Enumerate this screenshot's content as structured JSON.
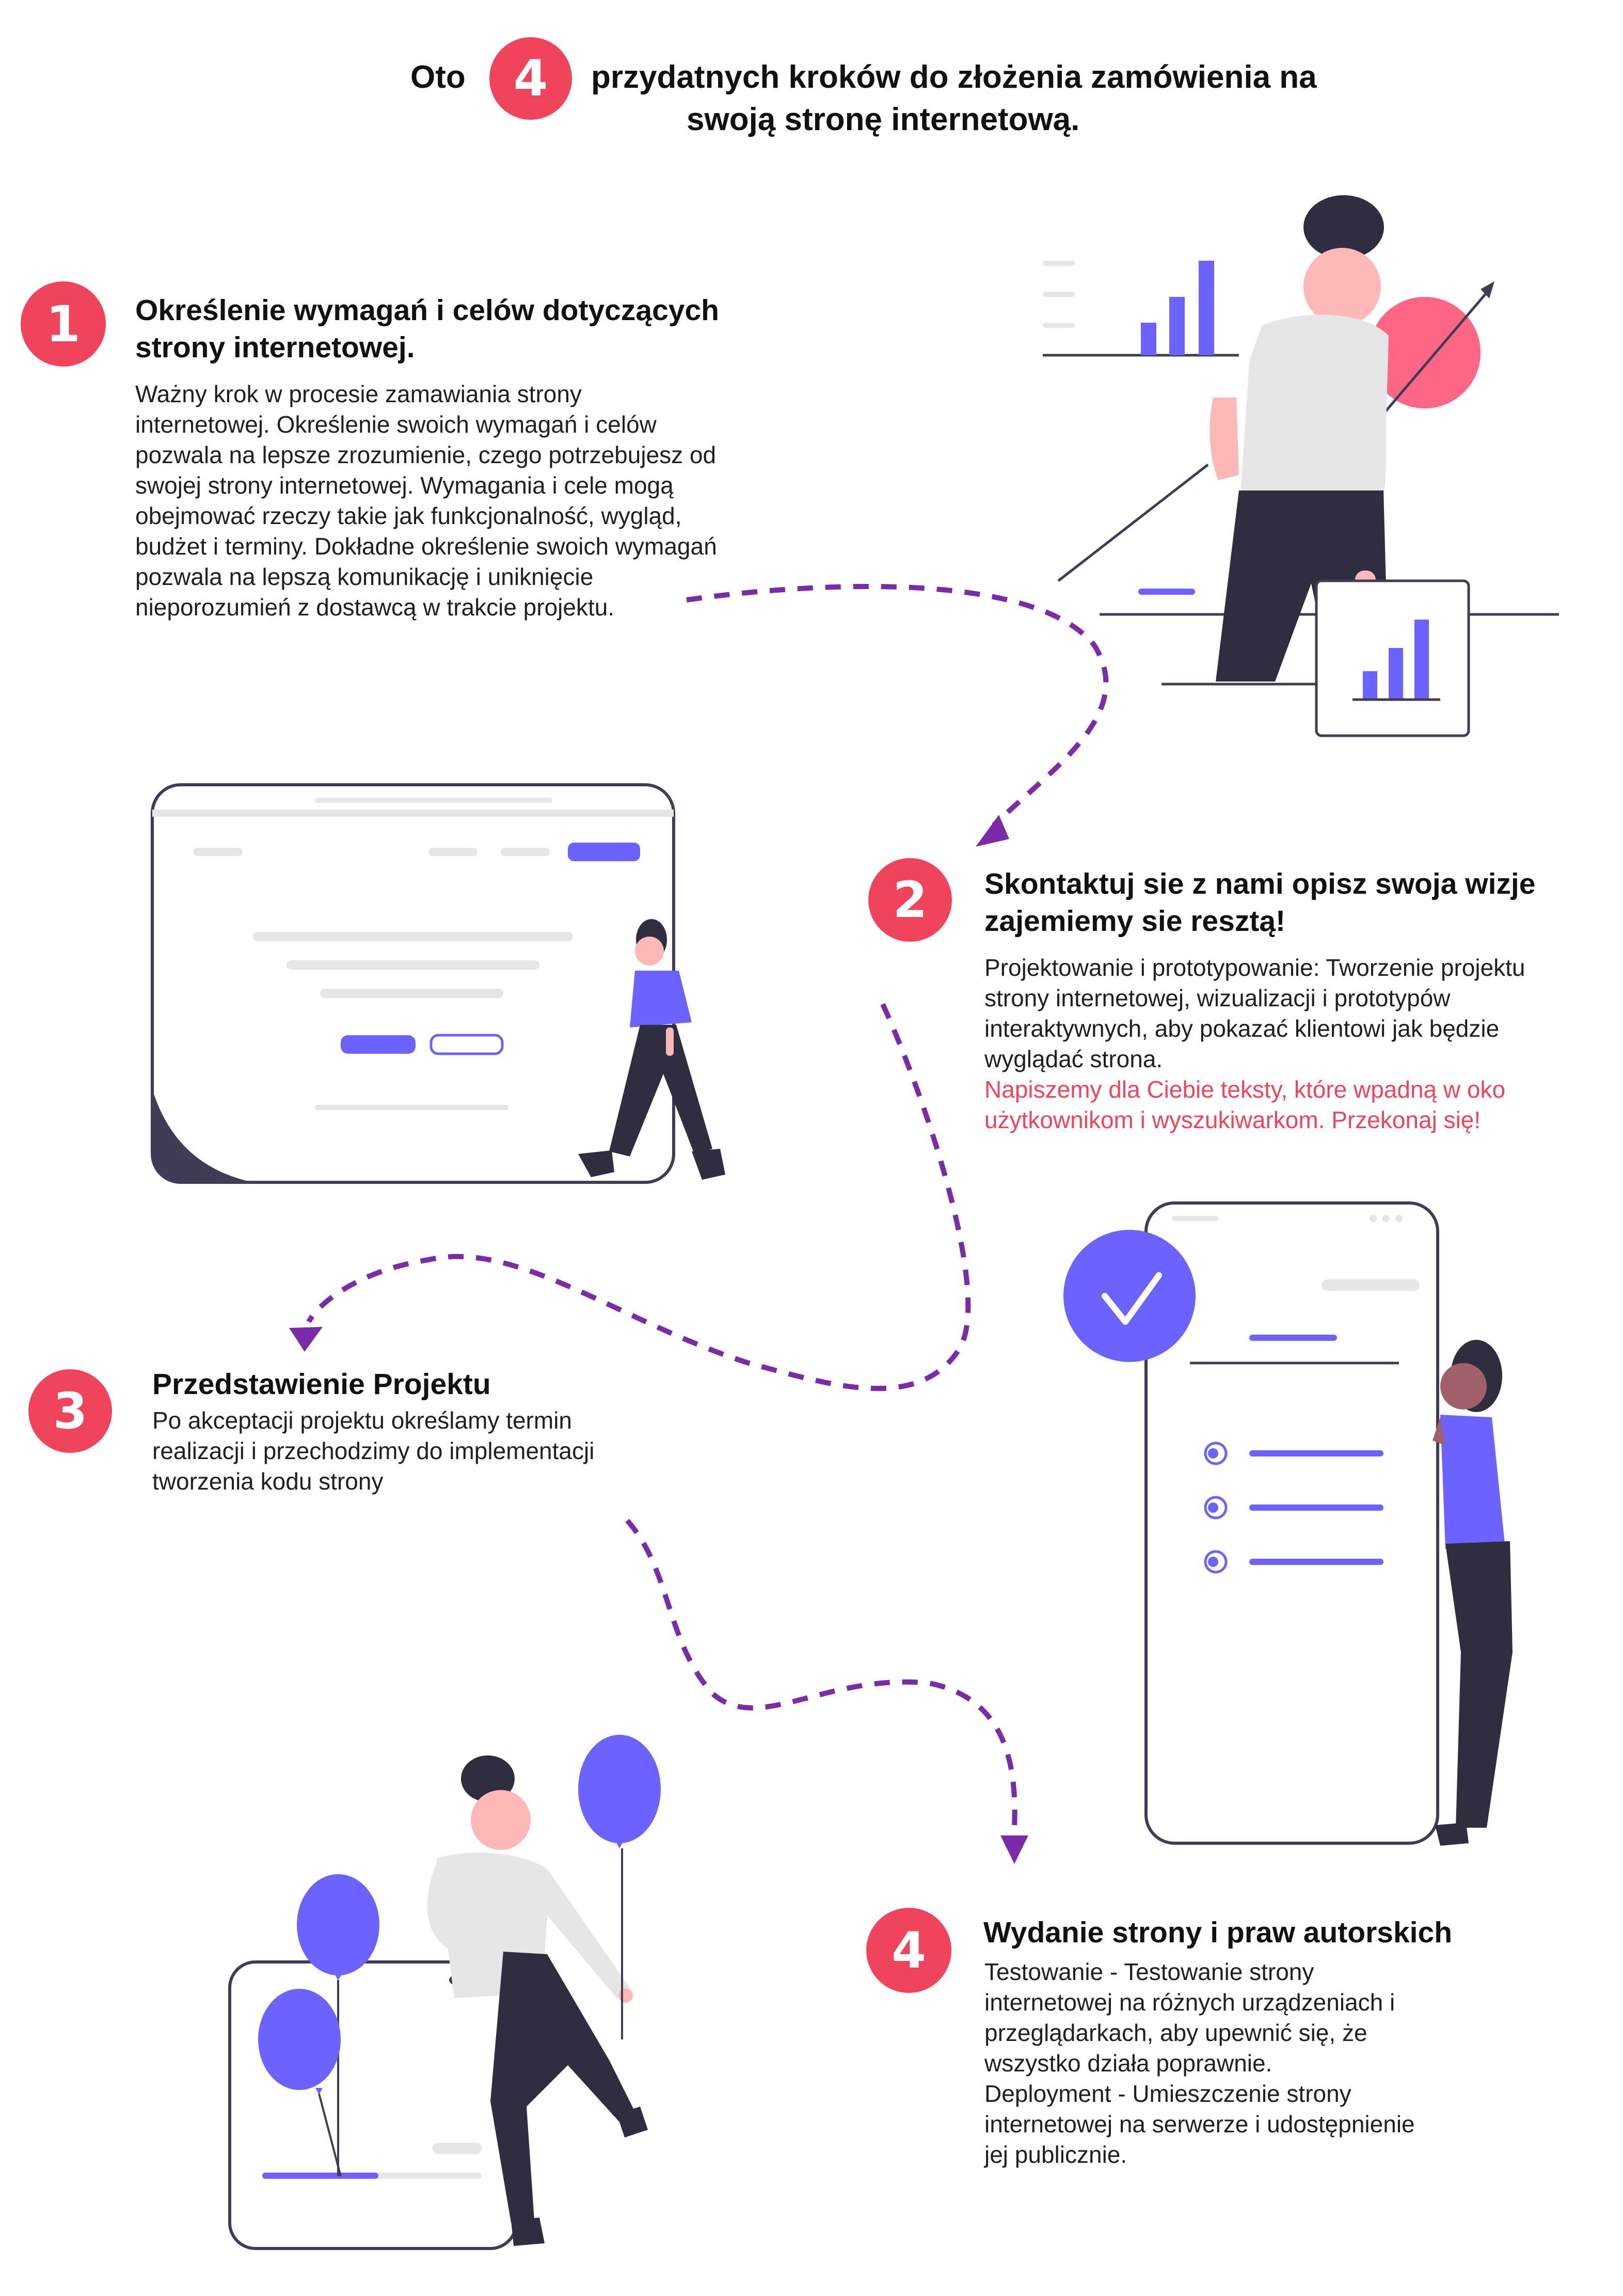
{
  "header": {
    "prefix": "Oto",
    "number": "4",
    "line1": "przydatnych kroków do złożenia zamówienia na",
    "line2": "swoją stronę internetową."
  },
  "steps": [
    {
      "number": "1",
      "title": "Określenie wymagań i celów dotyczących strony internetowej.",
      "body": "Ważny krok w procesie zamawiania strony\ninternetowej. Określenie swoich wymagań i celów\npozwala na lepsze zrozumienie, czego potrzebujesz od\nswojej strony internetowej. Wymagania i cele mogą\nobejmować rzeczy takie jak funkcjonalność, wygląd,\nbudżet i terminy. Dokładne określenie swoich wymagań\npozwala na lepszą komunikację i uniknięcie\nnieporozumień z dostawcą w trakcie projektu."
    },
    {
      "number": "2",
      "title": "Skontaktuj sie z nami opisz swoja wizje zajemiemy sie resztą!",
      "body": "Projektowanie i prototypowanie: Tworzenie projektu\nstrony internetowej, wizualizacji i prototypów\ninteraktywnych, aby pokazać klientowi jak będzie\nwyglądać strona.",
      "highlight": "Napiszemy dla Ciebie teksty, które wpadną w oko\nużytkownikom i wyszukiwarkom. Przekonaj się!"
    },
    {
      "number": "3",
      "title": "Przedstawienie Projektu",
      "body": "Po akceptacji projektu określamy termin\nrealizacji i przechodzimy do implementacji\ntworzenia kodu strony"
    },
    {
      "number": "4",
      "title": "Wydanie strony i praw autorskich",
      "body": "Testowanie - Testowanie strony\ninternetowej na różnych urządzeniach i\nprzeglądarkach, aby upewnić się, że\nwszystko działa poprawnie.\nDeployment - Umieszczenie strony\ninternetowej na serwerze i udostępnienie\njej publicznie."
    }
  ],
  "colors": {
    "accent_red": "#f0445d",
    "purple": "#6c63ff",
    "arrow_purple": "#7b2aa8",
    "dark": "#2f2e41"
  }
}
